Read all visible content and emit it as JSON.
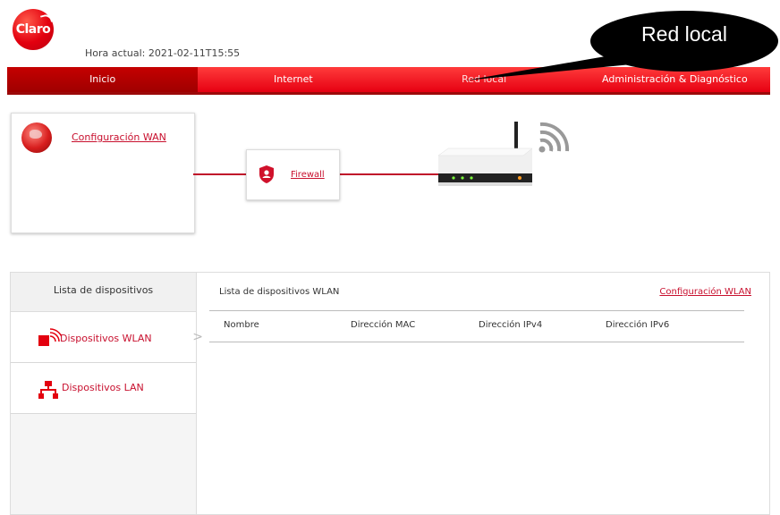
{
  "header": {
    "logo_text": "Claro",
    "current_time": "Hora actual: 2021-02-11T15:55"
  },
  "nav": {
    "tabs": [
      {
        "label": "Inicio",
        "active": true
      },
      {
        "label": "Internet",
        "active": false
      },
      {
        "label": "Red local",
        "active": false
      },
      {
        "label": "Administración & Diagnóstico",
        "active": false
      }
    ]
  },
  "callout": {
    "text": "Red local"
  },
  "topology": {
    "wan_link": "Configuración WAN",
    "firewall_link": "Firewall"
  },
  "devices": {
    "sidebar_title": "Lista de dispositivos",
    "items": [
      {
        "label": "Dispositivos WLAN",
        "icon": "wlan-device-icon",
        "active": true
      },
      {
        "label": "Dispositivos LAN",
        "icon": "lan-network-icon",
        "active": false
      }
    ],
    "content_title": "Lista de dispositivos WLAN",
    "config_link": "Configuración WLAN",
    "columns": [
      "Nombre",
      "Dirección MAC",
      "Dirección IPv4",
      "Dirección IPv6"
    ]
  },
  "colors": {
    "brand_red": "#e60012",
    "link_red": "#c8102e"
  }
}
